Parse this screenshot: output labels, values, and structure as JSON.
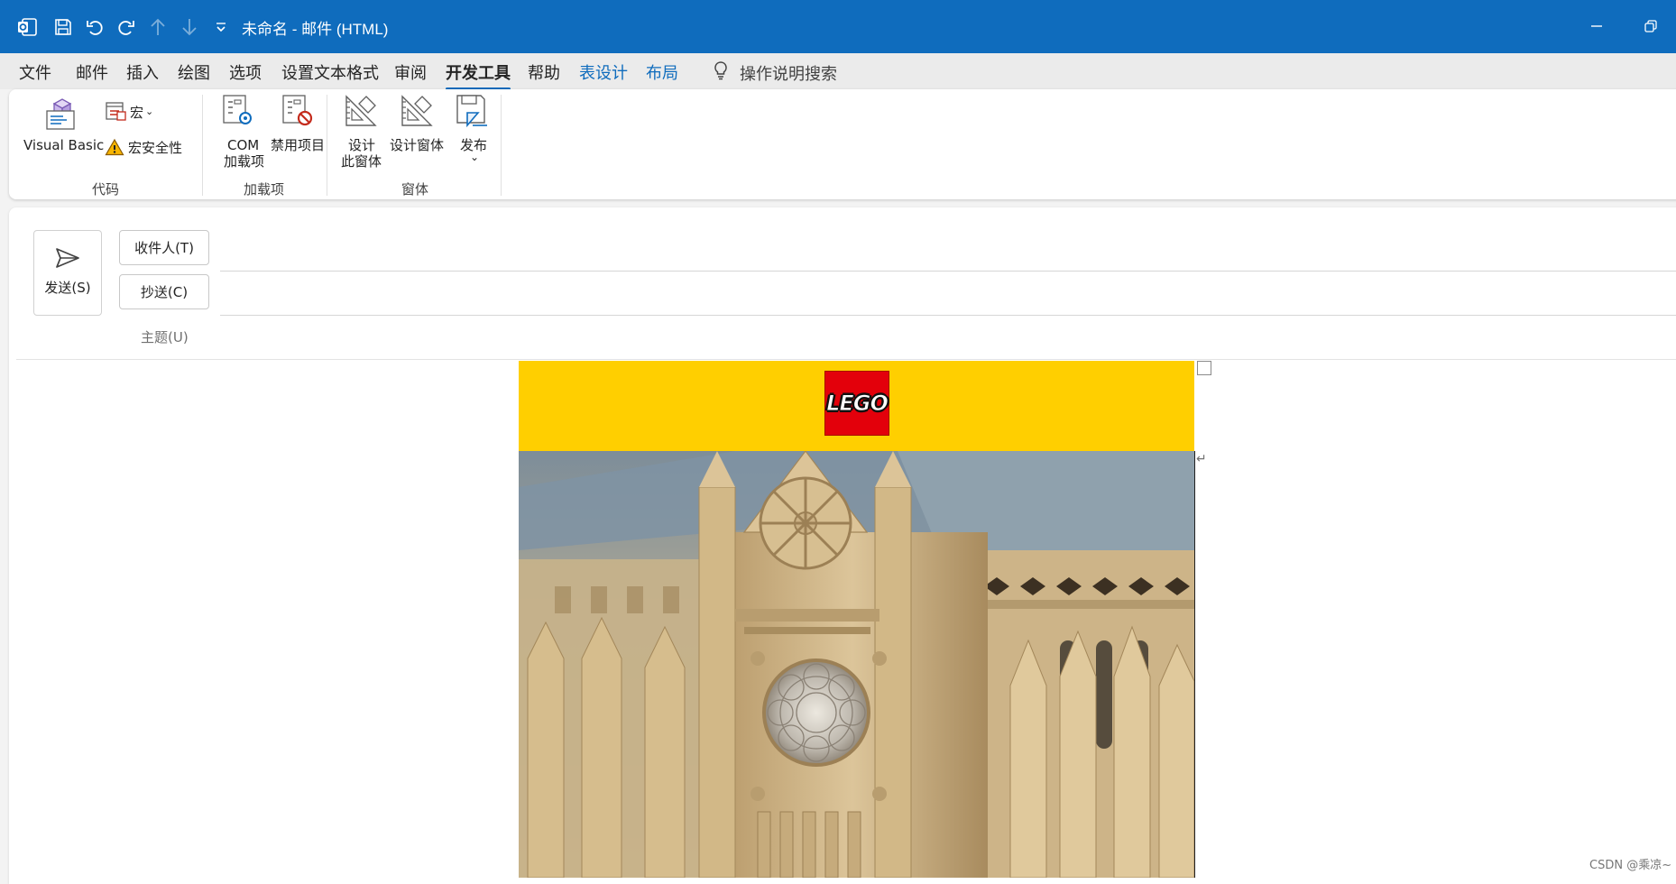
{
  "window": {
    "title": "未命名  -  邮件 (HTML)",
    "accent": "#0f6cbd"
  },
  "quick_access": {
    "icons": [
      "outlook-icon",
      "save-icon",
      "undo-icon",
      "redo-icon",
      "arrow-up-icon",
      "arrow-down-icon",
      "customize-icon"
    ]
  },
  "menu": {
    "tabs": [
      {
        "label": "文件"
      },
      {
        "label": "邮件"
      },
      {
        "label": "插入"
      },
      {
        "label": "绘图"
      },
      {
        "label": "选项"
      },
      {
        "label": "设置文本格式"
      },
      {
        "label": "审阅"
      },
      {
        "label": "开发工具",
        "active": true
      },
      {
        "label": "帮助"
      },
      {
        "label": "表设计",
        "contextual": true
      },
      {
        "label": "布局",
        "contextual": true
      }
    ],
    "tell_me": "操作说明搜索"
  },
  "ribbon": {
    "groups": [
      {
        "label": "代码",
        "items": [
          "Visual Basic",
          "宏",
          "宏安全性"
        ]
      },
      {
        "label": "加载项",
        "items": [
          "COM\n加载项",
          "禁用项目"
        ]
      },
      {
        "label": "窗体",
        "items": [
          "设计\n此窗体",
          "设计窗体",
          "发布"
        ]
      }
    ],
    "visual_basic": "Visual Basic",
    "macros": "宏",
    "macro_security": "宏安全性",
    "com_line1": "COM",
    "com_line2": "加载项",
    "disabled_items": "禁用项目",
    "design_this_line1": "设计",
    "design_this_line2": "此窗体",
    "design_form": "设计窗体",
    "publish": "发布",
    "group_code": "代码",
    "group_addins": "加载项",
    "group_forms": "窗体"
  },
  "compose": {
    "send": "发送(S)",
    "to": "收件人(T)",
    "cc": "抄送(C)",
    "subject": "主题(U)"
  },
  "email_body": {
    "brand_color": "#ffcf00",
    "logo_text": "LEGO"
  },
  "watermark": "CSDN @乘凉~"
}
